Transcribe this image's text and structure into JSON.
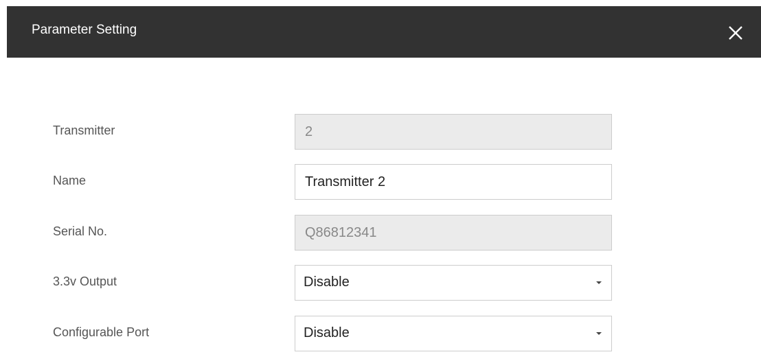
{
  "dialog": {
    "title": "Parameter Setting",
    "close_icon": "close-icon"
  },
  "fields": {
    "transmitter": {
      "label": "Transmitter",
      "value": "2"
    },
    "name": {
      "label": "Name",
      "value": "Transmitter 2"
    },
    "serial": {
      "label": "Serial No.",
      "value": "Q86812341"
    },
    "output_33v": {
      "label": "3.3v Output",
      "selected": "Disable"
    },
    "configurable_port": {
      "label": "Configurable Port",
      "selected": "Disable"
    }
  },
  "colors": {
    "titlebar_bg": "#323232",
    "readonly_bg": "#ebebeb",
    "border": "#cccccc",
    "label_text": "#555555"
  }
}
